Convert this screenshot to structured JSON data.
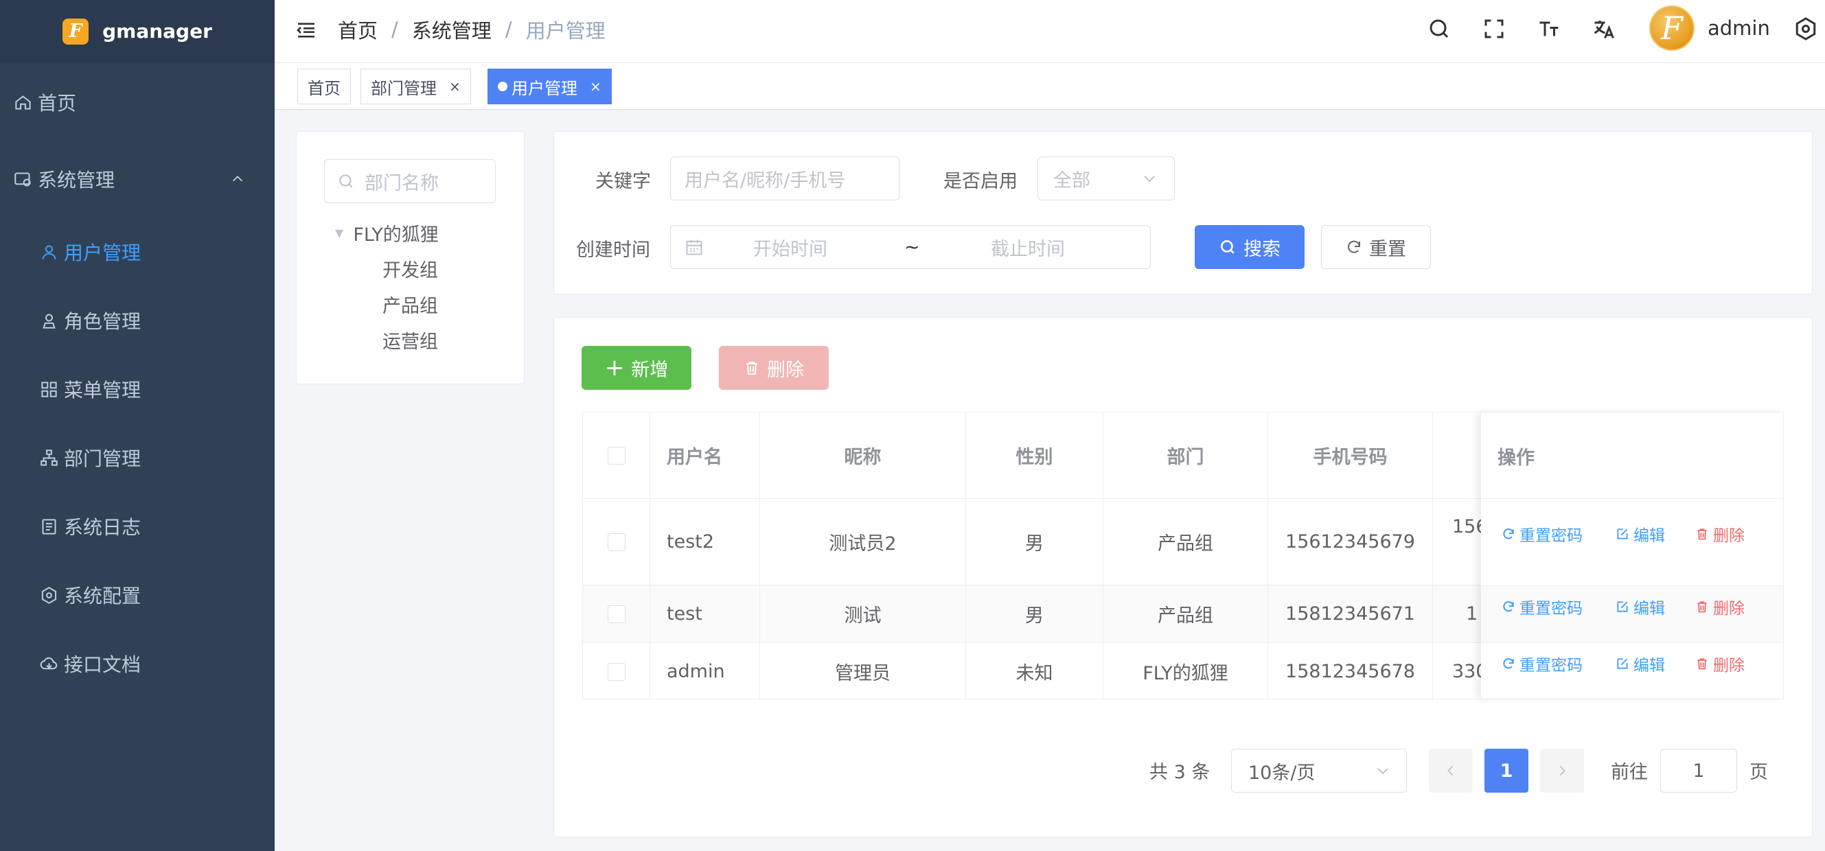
{
  "app": {
    "name": "gmanager",
    "logo_letter": "F"
  },
  "sidebar": {
    "items": [
      {
        "label": "首页",
        "icon": "home-icon"
      },
      {
        "label": "系统管理",
        "icon": "system-icon"
      },
      {
        "label": "用户管理",
        "icon": "user-icon",
        "active": true
      },
      {
        "label": "角色管理",
        "icon": "role-icon"
      },
      {
        "label": "菜单管理",
        "icon": "menu-icon"
      },
      {
        "label": "部门管理",
        "icon": "dept-icon"
      },
      {
        "label": "系统日志",
        "icon": "log-icon"
      },
      {
        "label": "系统配置",
        "icon": "config-icon"
      },
      {
        "label": "接口文档",
        "icon": "api-doc-icon"
      }
    ]
  },
  "navbar": {
    "breadcrumb": [
      "首页",
      "系统管理",
      "用户管理"
    ],
    "separator": "/",
    "user": {
      "name": "admin",
      "avatar_letter": "F"
    }
  },
  "tags": [
    {
      "label": "首页"
    },
    {
      "label": "部门管理",
      "close": "×"
    },
    {
      "label": "用户管理",
      "close": "×",
      "active": true
    }
  ],
  "dept_tree": {
    "search_placeholder": "部门名称",
    "root": "FLY的狐狸",
    "children": [
      "开发组",
      "产品组",
      "运营组"
    ]
  },
  "filters": {
    "keyword_label": "关键字",
    "keyword_placeholder": "用户名/昵称/手机号",
    "enabled_label": "是否启用",
    "enabled_value": "全部",
    "created_label": "创建时间",
    "start_placeholder": "开始时间",
    "range_sep": "~",
    "end_placeholder": "截止时间",
    "search_button": "搜索",
    "reset_button": "重置"
  },
  "actions": {
    "add_button": "新增",
    "delete_button": "删除"
  },
  "table": {
    "columns": [
      "用户名",
      "昵称",
      "性别",
      "部门",
      "手机号码",
      "操作"
    ],
    "rows": [
      {
        "username": "test2",
        "nickname": "测试员2",
        "gender": "男",
        "dept": "产品组",
        "phone": "15612345679",
        "partial": "156"
      },
      {
        "username": "test",
        "nickname": "测试",
        "gender": "男",
        "dept": "产品组",
        "phone": "15812345671",
        "partial": "1"
      },
      {
        "username": "admin",
        "nickname": "管理员",
        "gender": "未知",
        "dept": "FLY的狐狸",
        "phone": "15812345678",
        "partial": "330"
      }
    ],
    "row_actions": {
      "reset_pwd": "重置密码",
      "edit": "编辑",
      "delete": "删除"
    }
  },
  "pagination": {
    "total_text": "共 3 条",
    "page_size": "10条/页",
    "current_page": "1",
    "goto_label": "前往",
    "goto_value": "1",
    "page_suffix": "页"
  },
  "colors": {
    "sidebar_bg": "#304156",
    "accent": "#409eff",
    "success": "#67c23a",
    "danger": "#f56c6c"
  }
}
